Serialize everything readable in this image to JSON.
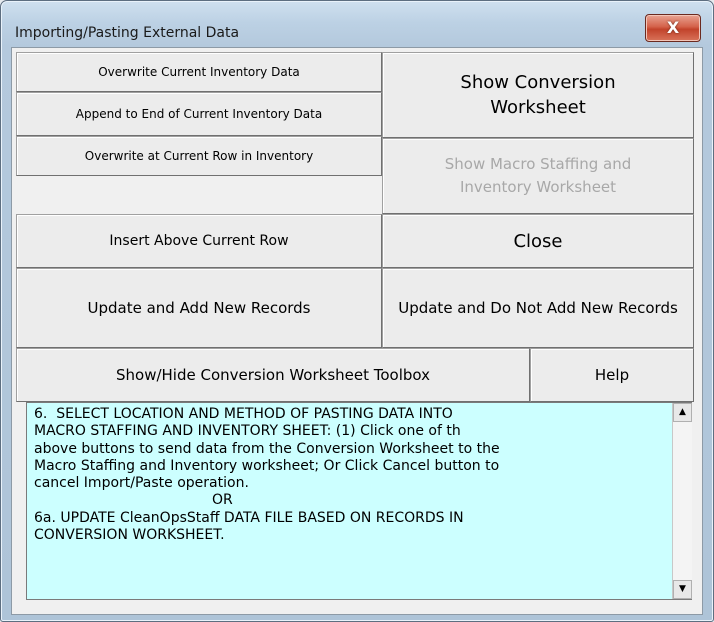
{
  "window": {
    "title": "Importing/Pasting External Data",
    "close_glyph": "X"
  },
  "buttons": {
    "overwrite_current": "Overwrite Current Inventory Data",
    "append_end": "Append to End of Current Inventory Data",
    "overwrite_row": "Overwrite at Current Row in Inventory",
    "show_conversion": "Show Conversion Worksheet",
    "show_macro": "Show Macro Staffing and Inventory Worksheet",
    "insert_above": "Insert Above Current Row",
    "close": "Close",
    "update_add": "Update and Add New Records",
    "update_no_add": "Update and Do Not Add New Records",
    "toolbox": "Show/Hide Conversion Worksheet Toolbox",
    "help": "Help"
  },
  "info": {
    "text": "6.  SELECT LOCATION AND METHOD OF PASTING DATA INTO\nMACRO STAFFING AND INVENTORY SHEET: (1) Click one of th\nabove buttons to send data from the Conversion Worksheet to the\nMacro Staffing and Inventory worksheet; Or Click Cancel button to\ncancel Import/Paste operation.\n                                        OR\n6a. UPDATE CleanOpsStaff DATA FILE BASED ON RECORDS IN\nCONVERSION WORKSHEET."
  },
  "scrollbar": {
    "up_glyph": "▲",
    "down_glyph": "▼"
  },
  "colors": {
    "info_background": "#ccffff",
    "close_button_red": "#c2432b"
  }
}
